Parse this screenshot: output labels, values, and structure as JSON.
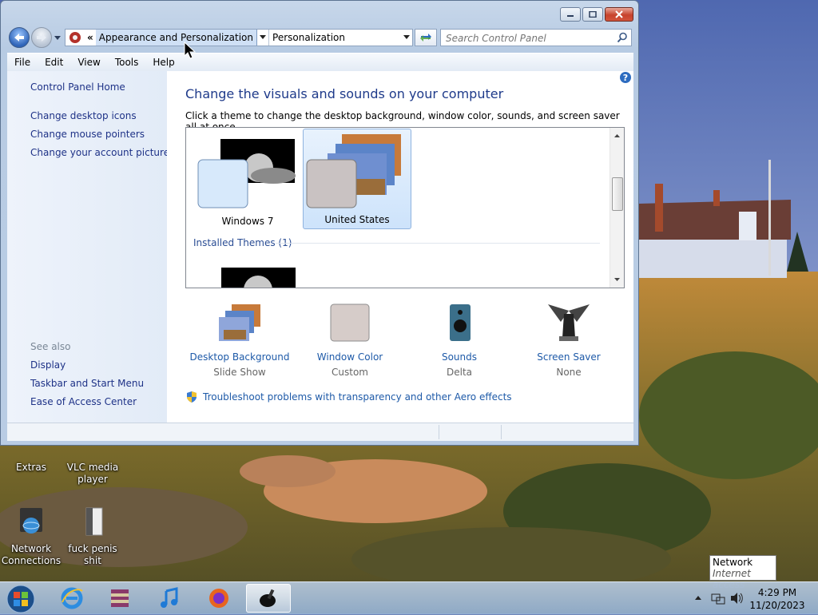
{
  "window": {
    "address": {
      "segment1": "Appearance and Personalization",
      "segment2": "Personalization"
    },
    "search_placeholder": "Search Control Panel",
    "menu": [
      "File",
      "Edit",
      "View",
      "Tools",
      "Help"
    ],
    "side": {
      "home": "Control Panel Home",
      "links": [
        "Change desktop icons",
        "Change mouse pointers",
        "Change your account picture"
      ],
      "see_also_label": "See also",
      "see_also": [
        "Display",
        "Taskbar and Start Menu",
        "Ease of Access Center"
      ]
    },
    "main": {
      "title": "Change the visuals and sounds on your computer",
      "description": "Click a theme to change the desktop background, window color, sounds, and screen saver all at once.",
      "themes": [
        {
          "label": "Windows 7",
          "selected": false
        },
        {
          "label": "United States",
          "selected": true
        }
      ],
      "installed_header": "Installed Themes (1)",
      "options": [
        {
          "title": "Desktop Background",
          "sub": "Slide Show"
        },
        {
          "title": "Window Color",
          "sub": "Custom"
        },
        {
          "title": "Sounds",
          "sub": "Delta"
        },
        {
          "title": "Screen Saver",
          "sub": "None"
        }
      ],
      "aero_link": "Troubleshoot problems with transparency and other Aero effects"
    }
  },
  "desktop": {
    "icons": [
      {
        "label": "Extras"
      },
      {
        "label": "VLC media player"
      },
      {
        "label": "Network Connections"
      },
      {
        "label": "fuck penis shit"
      }
    ]
  },
  "taskbar": {
    "time": "4:29 PM",
    "date": "11/20/2023"
  },
  "tooltip": {
    "title": "Network",
    "subtitle": "Internet access"
  },
  "colors": {
    "link": "#1e5aa8",
    "title": "#1e3a8a",
    "side_link": "#1e3287"
  }
}
